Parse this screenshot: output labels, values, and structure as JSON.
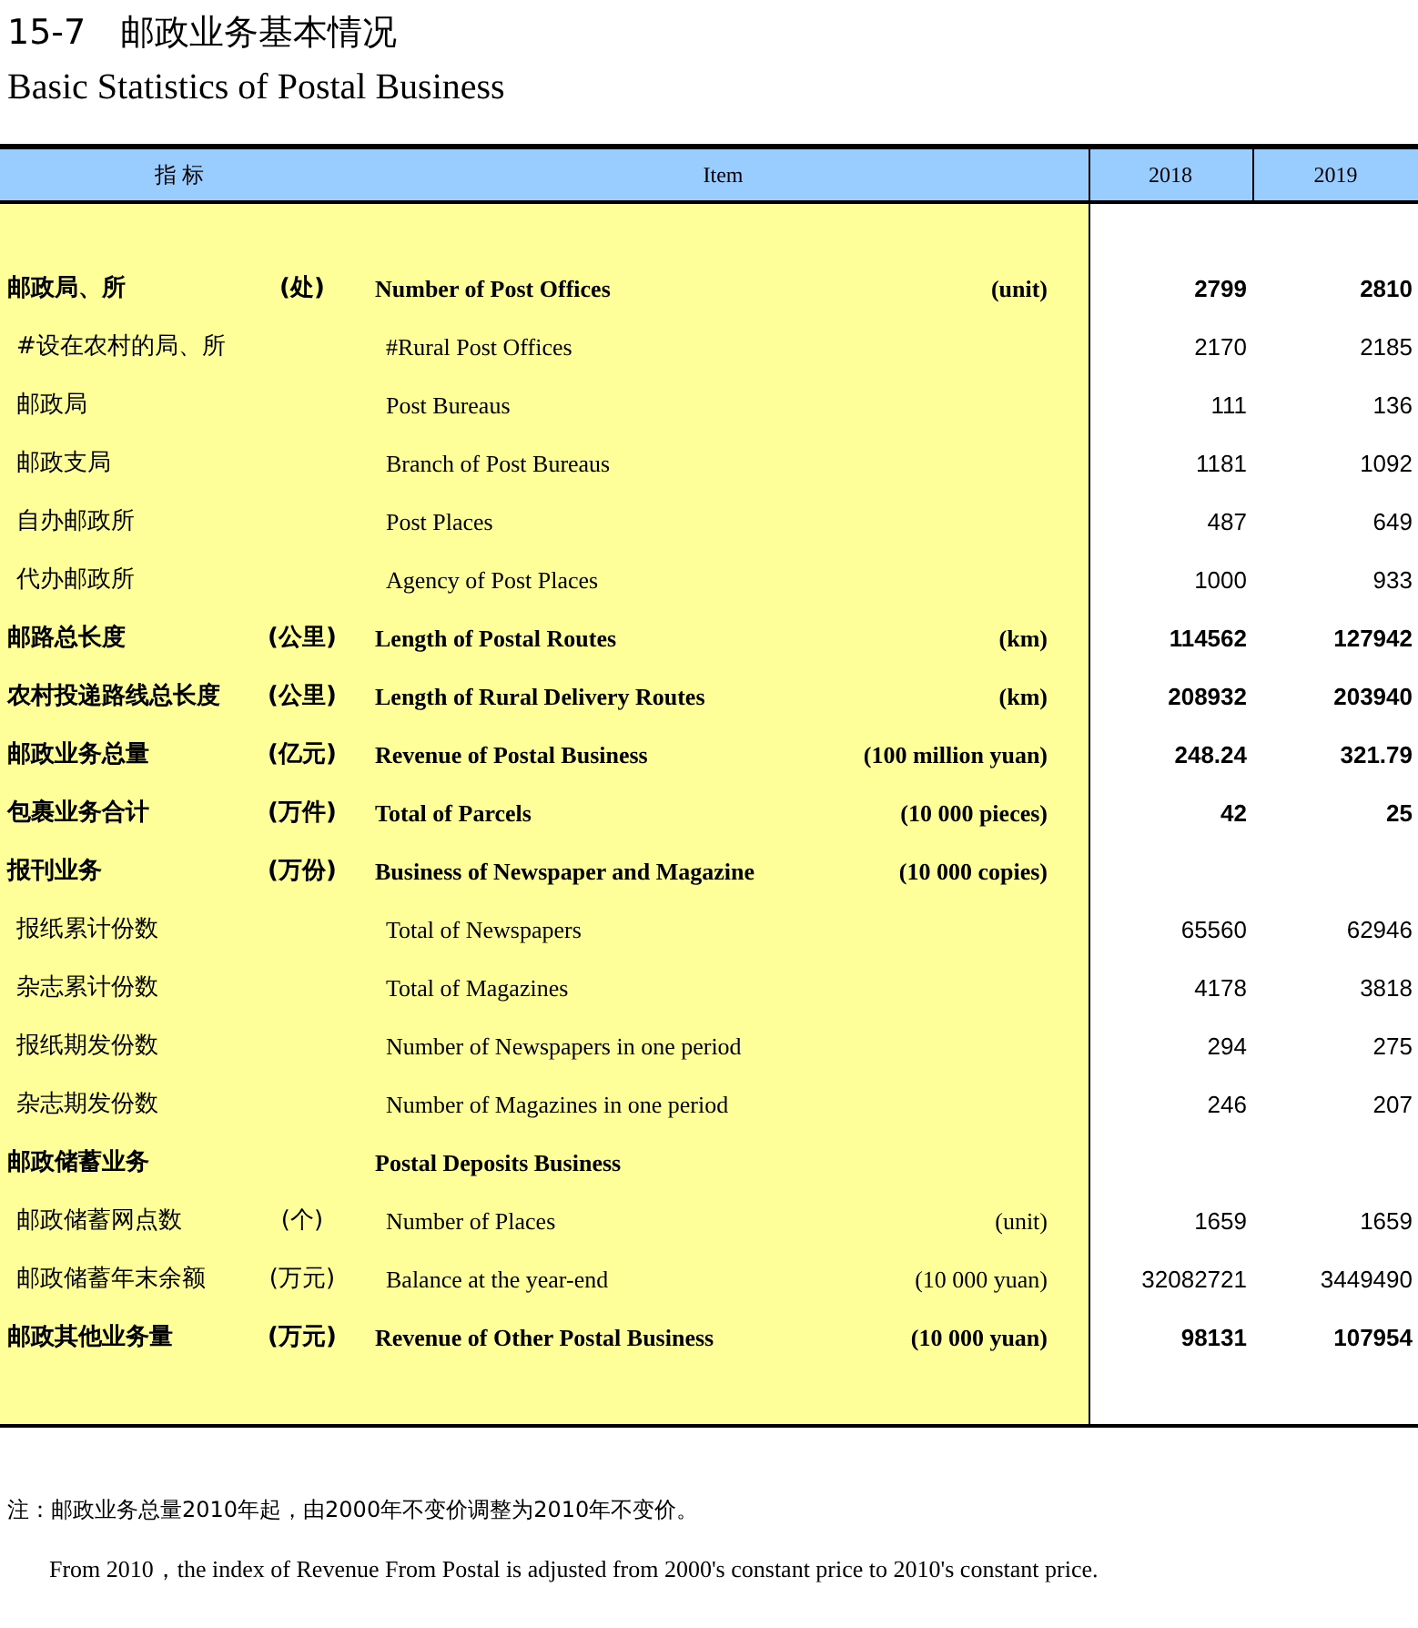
{
  "title": "15-7　邮政业务基本情况",
  "subtitle": "Basic Statistics of Postal Business",
  "columns": [
    "指 标",
    "Item",
    "2018",
    "2019"
  ],
  "rows": [
    {
      "kind": "main",
      "zh": "邮政局、所",
      "zh_unit": "(处)",
      "en": "Number of Post Offices",
      "en_unit": "(unit)",
      "v2018": "2799",
      "v2019": "2810"
    },
    {
      "kind": "sub",
      "zh": "#设在农村的局、所",
      "en": "#Rural Post Offices",
      "v2018": "2170",
      "v2019": "2185"
    },
    {
      "kind": "sub",
      "zh": "邮政局",
      "en": "Post Bureaus",
      "v2018": "111",
      "v2019": "136"
    },
    {
      "kind": "sub",
      "zh": "邮政支局",
      "en": "Branch of Post Bureaus",
      "v2018": "1181",
      "v2019": "1092"
    },
    {
      "kind": "sub",
      "zh": "自办邮政所",
      "en": "Post Places",
      "v2018": "487",
      "v2019": "649"
    },
    {
      "kind": "sub",
      "zh": "代办邮政所",
      "en": "Agency of Post Places",
      "v2018": "1000",
      "v2019": "933"
    },
    {
      "kind": "main",
      "zh": "邮路总长度",
      "zh_unit": "(公里)",
      "en": "Length of Postal Routes",
      "en_unit": "(km)",
      "v2018": "114562",
      "v2019": "127942"
    },
    {
      "kind": "main",
      "zh": "农村投递路线总长度",
      "zh_unit": "(公里)",
      "en": "Length of Rural Delivery Routes",
      "en_unit": "(km)",
      "v2018": "208932",
      "v2019": "203940"
    },
    {
      "kind": "main",
      "zh": "邮政业务总量",
      "zh_unit": "(亿元)",
      "en": "Revenue of Postal Business",
      "en_unit": "(100  million yuan)",
      "v2018": "248.24",
      "v2019": "321.79"
    },
    {
      "kind": "main",
      "zh": "包裹业务合计",
      "zh_unit": "(万件)",
      "en": "Total of Parcels",
      "en_unit": "(10 000 pieces)",
      "v2018": "42",
      "v2019": "25"
    },
    {
      "kind": "main",
      "zh": "报刊业务",
      "zh_unit": "(万份)",
      "en": "Business of Newspaper and Magazine",
      "en_unit": "(10 000 copies)"
    },
    {
      "kind": "sub",
      "zh": "报纸累计份数",
      "en": "Total of Newspapers",
      "v2018": "65560",
      "v2019": "62946"
    },
    {
      "kind": "sub",
      "zh": "杂志累计份数",
      "en": "Total of Magazines",
      "v2018": "4178",
      "v2019": "3818"
    },
    {
      "kind": "sub",
      "zh": "报纸期发份数",
      "en": "Number of Newspapers in one period",
      "v2018": "294",
      "v2019": "275"
    },
    {
      "kind": "sub",
      "zh": "杂志期发份数",
      "en": "Number of Magazines in one period",
      "v2018": "246",
      "v2019": "207"
    },
    {
      "kind": "main",
      "zh": "邮政储蓄业务",
      "en": "Postal Deposits Business"
    },
    {
      "kind": "sub",
      "zh": "邮政储蓄网点数",
      "zh_unit": "(个)",
      "en": "Number of Places",
      "en_unit": "(unit)",
      "v2018": "1659",
      "v2019": "1659"
    },
    {
      "kind": "sub",
      "zh": "邮政储蓄年末余额",
      "zh_unit": "(万元)",
      "en": "Balance at the year-end",
      "en_unit": "(10 000 yuan)",
      "v2018": "32082721",
      "v2019": "3449490"
    },
    {
      "kind": "main",
      "zh": "邮政其他业务量",
      "zh_unit": "(万元)",
      "en": "Revenue of Other Postal Business",
      "en_unit": "(10 000 yuan)",
      "v2018": "98131",
      "v2019": "107954"
    }
  ],
  "notes": [
    "注：邮政业务总量2010年起，由2000年不变价调整为2010年不变价。",
    "From 2010，the index of Revenue From Postal is adjusted from 2000's constant price to 2010's constant price."
  ]
}
